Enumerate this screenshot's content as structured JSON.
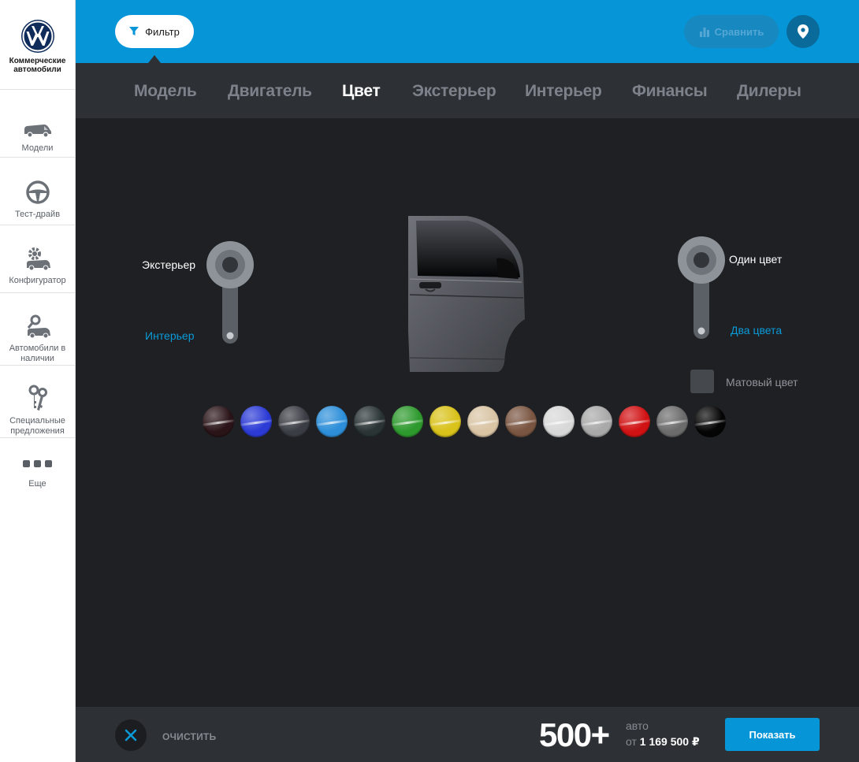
{
  "sidebar": {
    "brand": "Коммерческие автомобили",
    "items": [
      {
        "icon": "van-icon",
        "label": "Модели"
      },
      {
        "icon": "steering-wheel-icon",
        "label": "Тест-драйв"
      },
      {
        "icon": "configurator-icon",
        "label": "Конфигуратор"
      },
      {
        "icon": "car-search-icon",
        "label": "Автомобили в наличии"
      },
      {
        "icon": "keys-icon",
        "label": "Специальные предложения"
      },
      {
        "icon": "more-dots-icon",
        "label": "Еще"
      }
    ]
  },
  "topbar": {
    "filter_label": "Фильтр",
    "compare_label": "Сравнить",
    "location_icon": "location-pin-icon",
    "color": "#0696d7"
  },
  "tabs": {
    "items": [
      "Модель",
      "Двигатель",
      "Цвет",
      "Экстерьер",
      "Интерьер",
      "Финансы",
      "Дилеры"
    ],
    "active": "Цвет"
  },
  "main": {
    "side_toggle": {
      "selected": "Экстерьер",
      "other": "Интерьер"
    },
    "tone_toggle": {
      "selected": "Один цвет",
      "other": "Два цвета"
    },
    "matte_label": "Матовый цвет",
    "matte_checked": false,
    "swatches": [
      "#2a1418",
      "#2c3bd6",
      "#3a3d44",
      "#2d8fd9",
      "#2a3435",
      "#2e9a2e",
      "#d9c21a",
      "#d9c4a4",
      "#7a5541",
      "#d8d8d8",
      "#a9a9a9",
      "#d11214",
      "#6c6c6c",
      "#050505"
    ]
  },
  "bottombar": {
    "clear_label": "ОЧИСТИТЬ",
    "count": "500+",
    "unit": "авто",
    "price_prefix": "от",
    "price": "1 169 500 ₽",
    "show_label": "Показать"
  }
}
